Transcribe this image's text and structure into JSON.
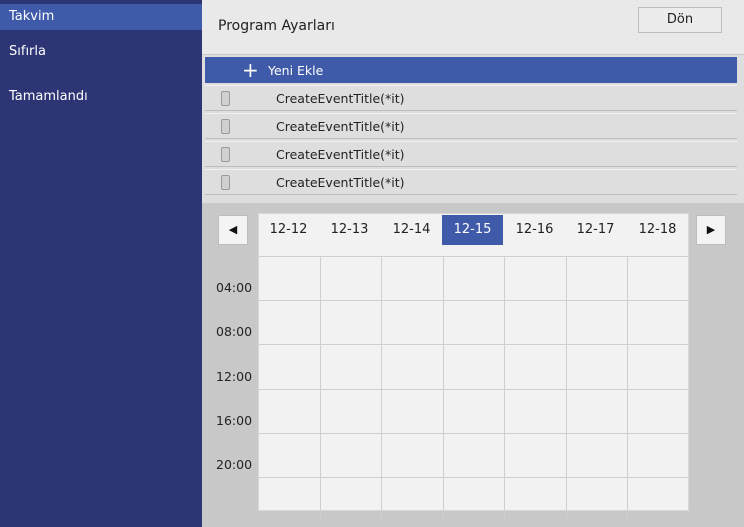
{
  "sidebar": {
    "items": [
      {
        "label": "Takvim"
      },
      {
        "label": "Sıfırla"
      },
      {
        "label": "Tamamlandı"
      }
    ]
  },
  "header": {
    "title": "Program Ayarları",
    "back_label": "Dön"
  },
  "events": {
    "add_label": "Yeni Ekle",
    "items": [
      {
        "label": "CreateEventTitle(*it)"
      },
      {
        "label": "CreateEventTitle(*it)"
      },
      {
        "label": "CreateEventTitle(*it)"
      },
      {
        "label": "CreateEventTitle(*it)"
      }
    ]
  },
  "calendar": {
    "prev": "◀",
    "next": "▶",
    "days": [
      "12-12",
      "12-13",
      "12-14",
      "12-15",
      "12-16",
      "12-17",
      "12-18"
    ],
    "selected_day": "12-15",
    "times": [
      "04:00",
      "08:00",
      "12:00",
      "16:00",
      "20:00"
    ]
  },
  "colors": {
    "sidebar_bg": "#2e3575",
    "accent": "#3f5aa8"
  }
}
